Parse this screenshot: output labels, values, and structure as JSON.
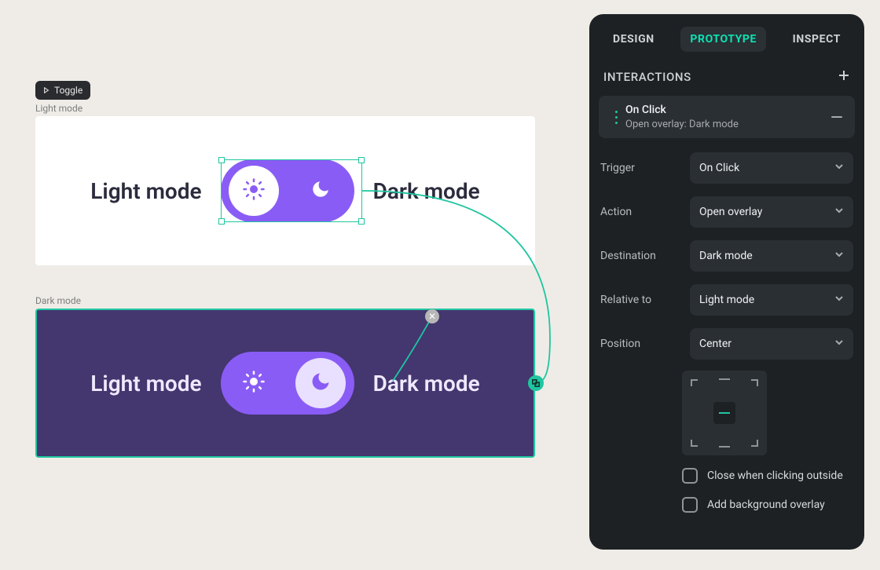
{
  "canvas": {
    "component_badge": "Toggle",
    "frames": {
      "light": {
        "label": "Light mode",
        "left_text": "Light mode",
        "right_text": "Dark mode"
      },
      "dark": {
        "label": "Dark mode",
        "left_text": "Light mode",
        "right_text": "Dark mode"
      }
    }
  },
  "panel": {
    "tabs": {
      "design": "DESIGN",
      "prototype": "PROTOTYPE",
      "inspect": "INSPECT"
    },
    "section_title": "INTERACTIONS",
    "interaction": {
      "title": "On Click",
      "subtitle": "Open overlay: Dark mode"
    },
    "rows": {
      "trigger": {
        "label": "Trigger",
        "value": "On Click"
      },
      "action": {
        "label": "Action",
        "value": "Open overlay"
      },
      "destination": {
        "label": "Destination",
        "value": "Dark mode"
      },
      "relative_to": {
        "label": "Relative to",
        "value": "Light mode"
      },
      "position": {
        "label": "Position",
        "value": "Center"
      }
    },
    "checks": {
      "close_outside": "Close when clicking outside",
      "bg_overlay": "Add background overlay"
    }
  }
}
